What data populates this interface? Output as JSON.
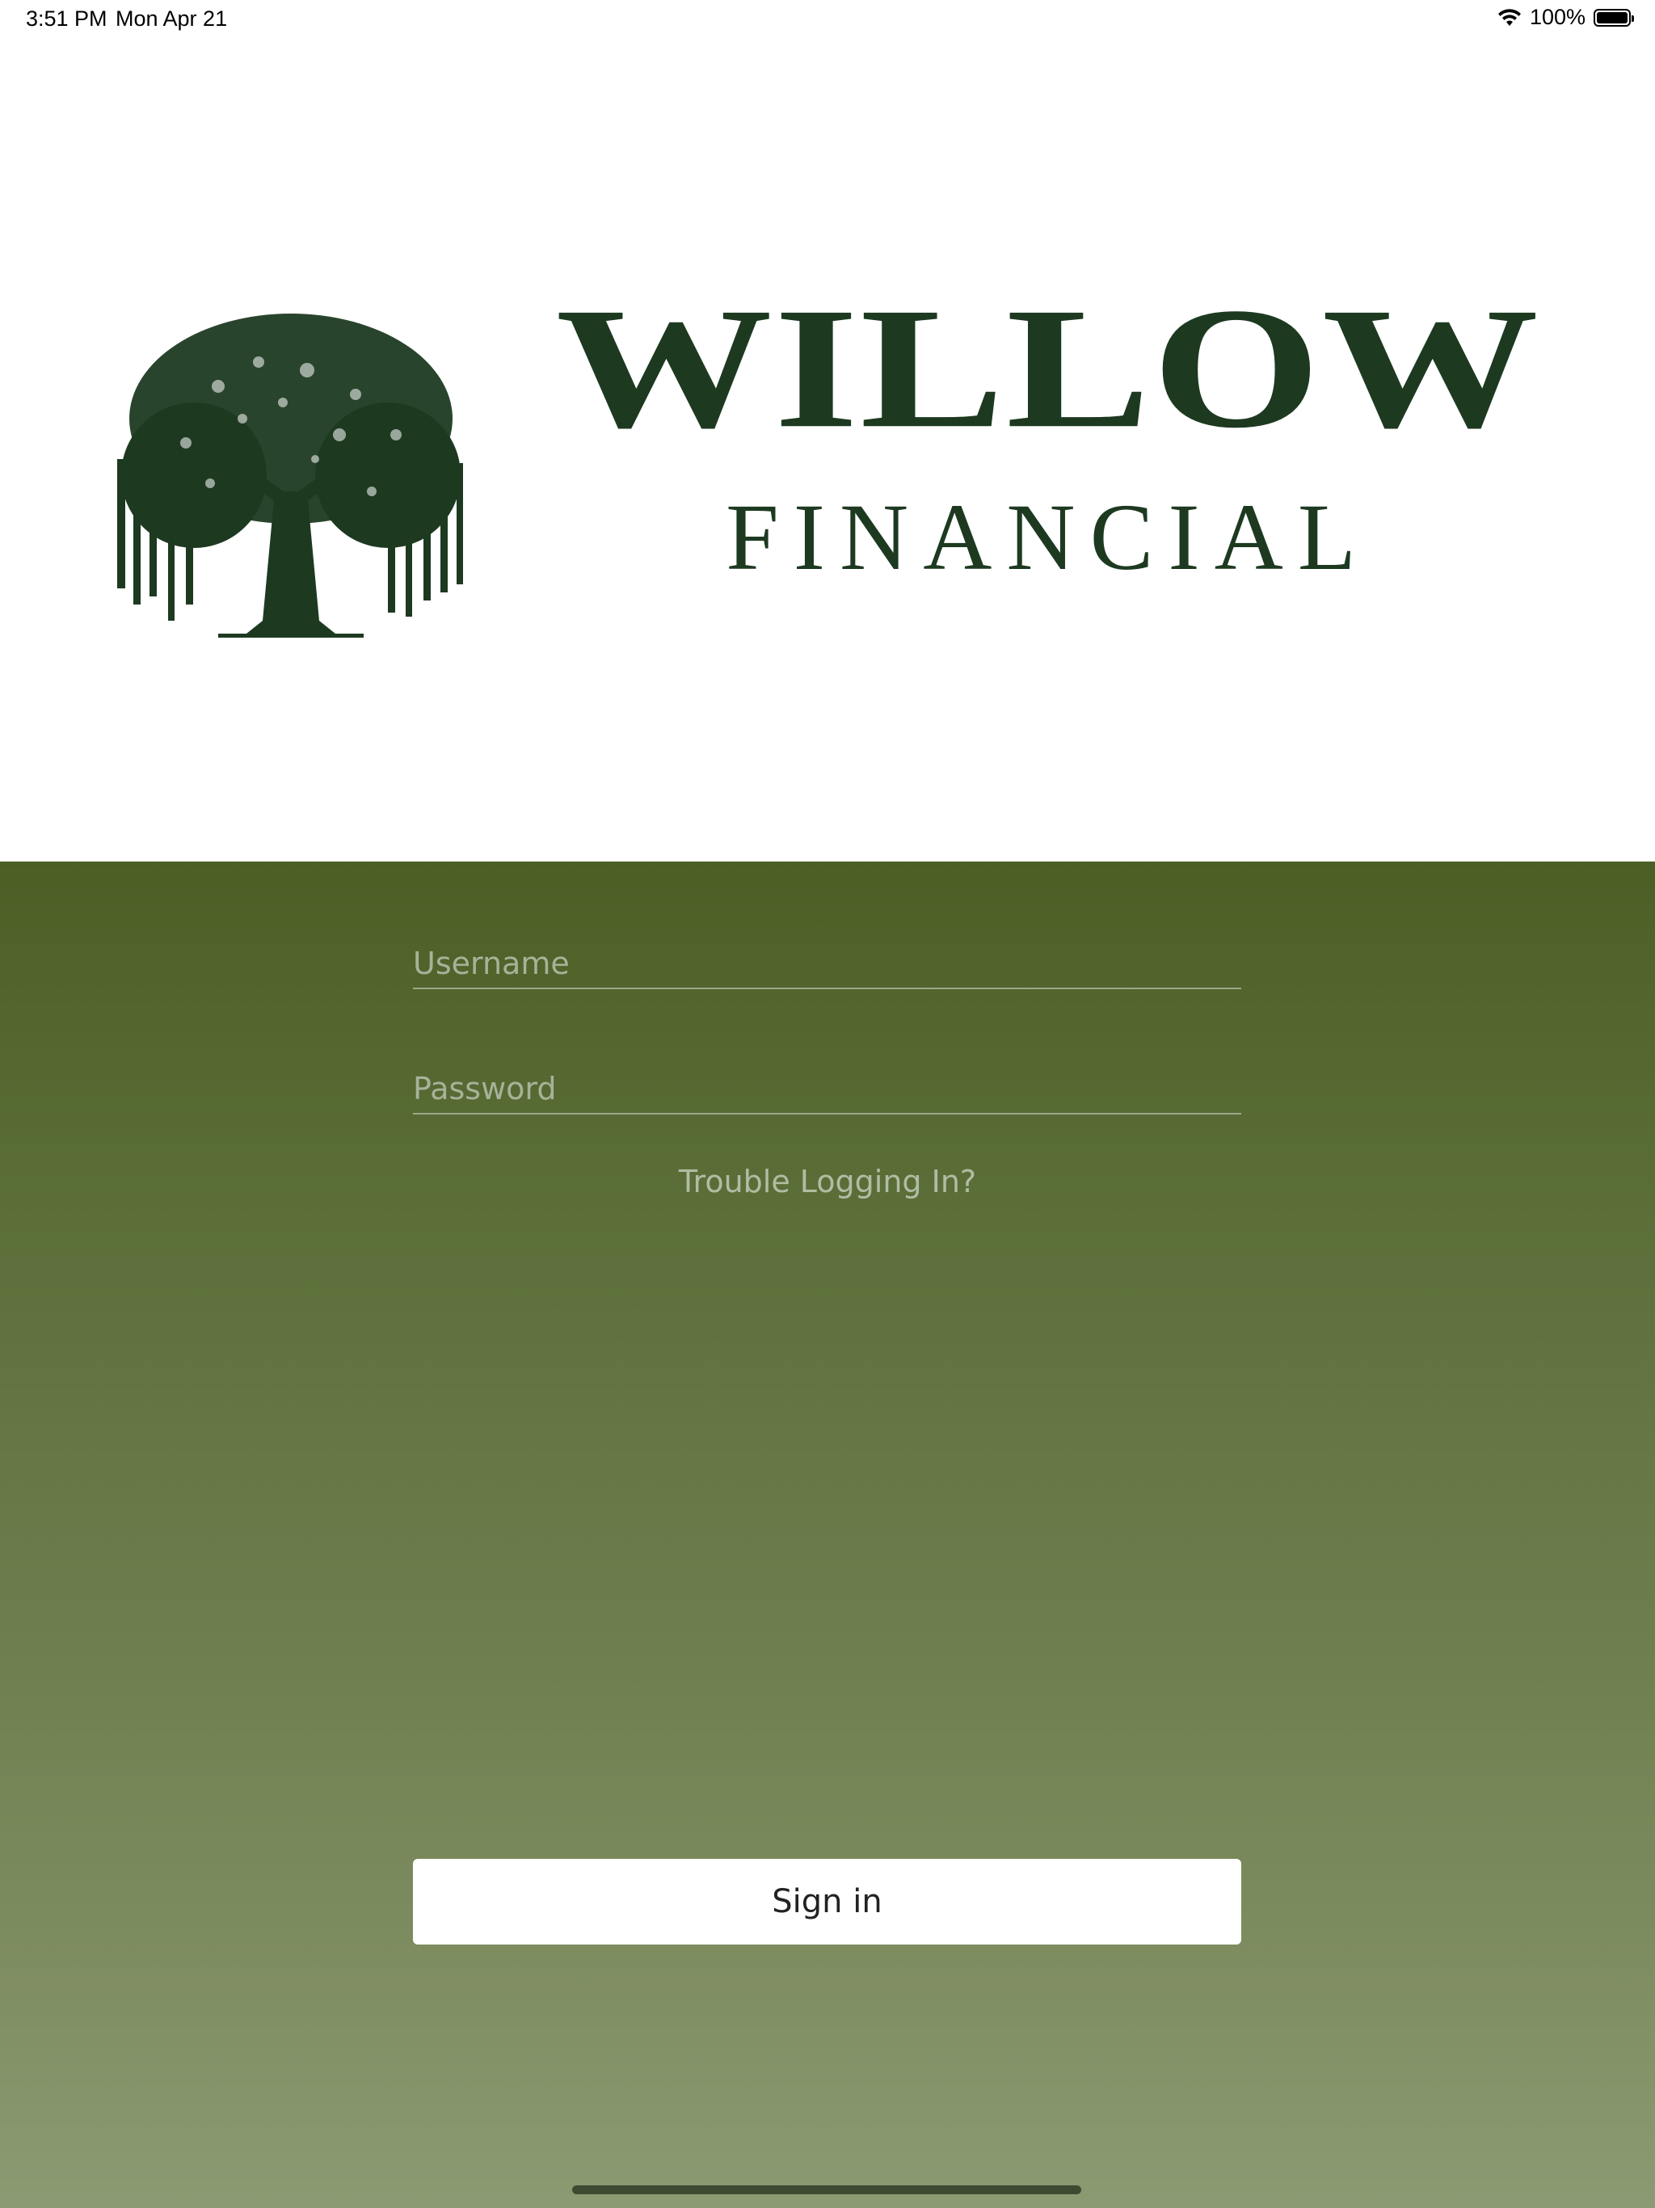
{
  "status_bar": {
    "time": "3:51 PM",
    "date": "Mon Apr 21",
    "battery": "100%",
    "wifi_icon": "wifi-icon",
    "battery_icon": "battery-icon"
  },
  "brand": {
    "name": "WILLOW",
    "tagline": "FINANCIAL",
    "logo_icon": "willow-tree-icon",
    "color": "#1d3a21"
  },
  "login": {
    "username_placeholder": "Username",
    "username_value": "",
    "password_placeholder": "Password",
    "password_value": "",
    "trouble_link": "Trouble Logging In?",
    "signin_label": "Sign in"
  },
  "colors": {
    "panel_top": "#4b5f25",
    "panel_bottom": "#8b9a72",
    "button_bg": "#ffffff"
  }
}
